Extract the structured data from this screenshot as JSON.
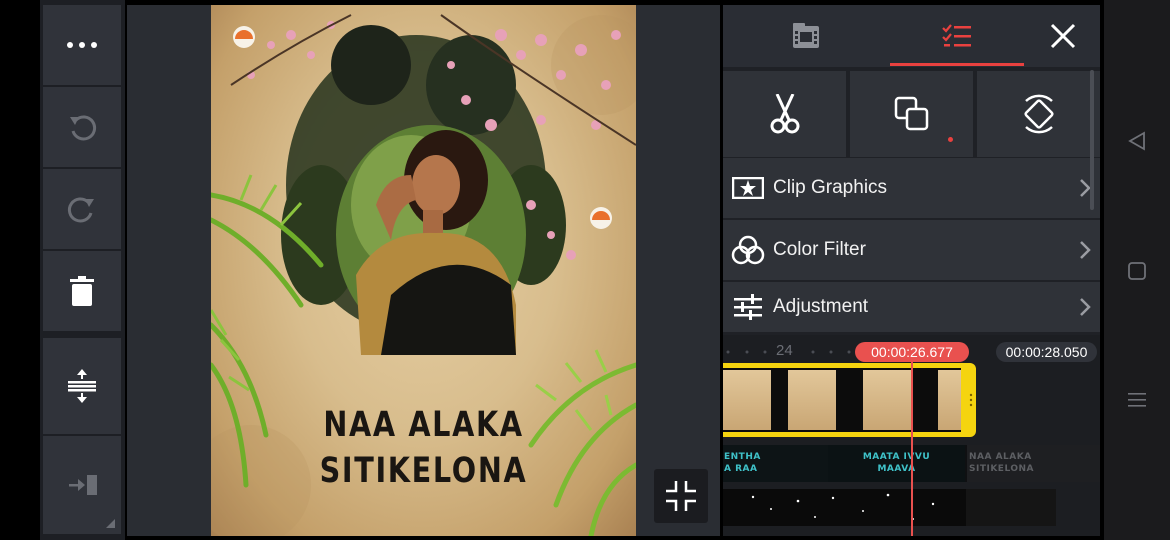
{
  "toolbar": {
    "more": "more-options",
    "undo": "undo",
    "redo": "redo",
    "delete": "delete",
    "split_screen": "split-screen",
    "exit": "exit"
  },
  "preview": {
    "title_line1": "NAA ALAKA",
    "title_line2": "SITIKELONA"
  },
  "panel": {
    "tabs": [
      {
        "name": "media-tab",
        "icon": "film-icon",
        "active": false
      },
      {
        "name": "edit-tab",
        "icon": "checklist-icon",
        "active": true
      }
    ],
    "close_icon": "close-icon",
    "tools": [
      "scissors-icon",
      "layer-icon",
      "rotate-icon"
    ],
    "menu": [
      {
        "label": "Clip Graphics",
        "icon": "clip-graphics-icon"
      },
      {
        "label": "Color Filter",
        "icon": "color-filter-icon"
      },
      {
        "label": "Adjustment",
        "icon": "adjustment-icon"
      }
    ]
  },
  "timeline": {
    "ruler_label": "24",
    "current_time": "00:00:26.677",
    "total_time": "00:00:28.050",
    "text_clips": [
      {
        "line1": "ENTHA",
        "line2": "A RAA"
      },
      {
        "line1": "MAATA IVVU",
        "line2": "MAAVA"
      },
      {
        "line1": "NAA ALAKA",
        "line2": "SITIKELONA"
      }
    ]
  },
  "colors": {
    "accent": "#e9413f",
    "clip_border": "#f5d40f",
    "text_clip": "#3fc2c9"
  },
  "nav": [
    "back-icon",
    "home-icon",
    "recents-icon"
  ]
}
